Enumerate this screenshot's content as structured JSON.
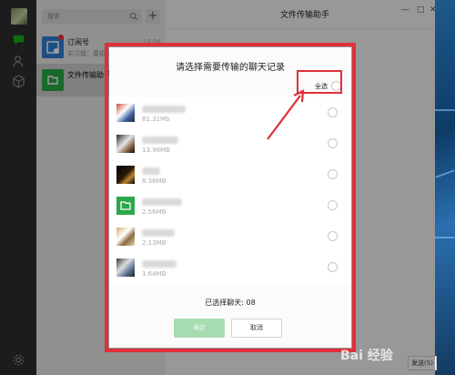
{
  "window": {
    "title": "文件传输助手",
    "minimize": "—",
    "maximize": "□",
    "close": "✕"
  },
  "rail": {
    "icons": [
      "chat-icon",
      "contacts-icon",
      "cube-icon",
      "settings-icon"
    ]
  },
  "chatlist": {
    "search_placeholder": "搜索",
    "add_label": "+",
    "items": [
      {
        "title": "订阅号",
        "subtitle": "实习僧：春招...",
        "time": "14:04",
        "badge": true
      },
      {
        "title": "文件传输助手",
        "subtitle": "",
        "time": "",
        "badge": false
      }
    ]
  },
  "dialog": {
    "title": "请选择需要传输的聊天记录",
    "select_all_label": "全选",
    "rows": [
      {
        "size": "61.31Mb"
      },
      {
        "size": "13.96MB"
      },
      {
        "size": "8.36MB"
      },
      {
        "size": "2.56MB"
      },
      {
        "size": "2.13MB"
      },
      {
        "size": "1.64MB"
      }
    ],
    "selected_count_label": "已选择聊天: 08",
    "ok_label": "确定",
    "cancel_label": "取消"
  },
  "send_label": "发送(S)",
  "watermark": "Bai 经验"
}
